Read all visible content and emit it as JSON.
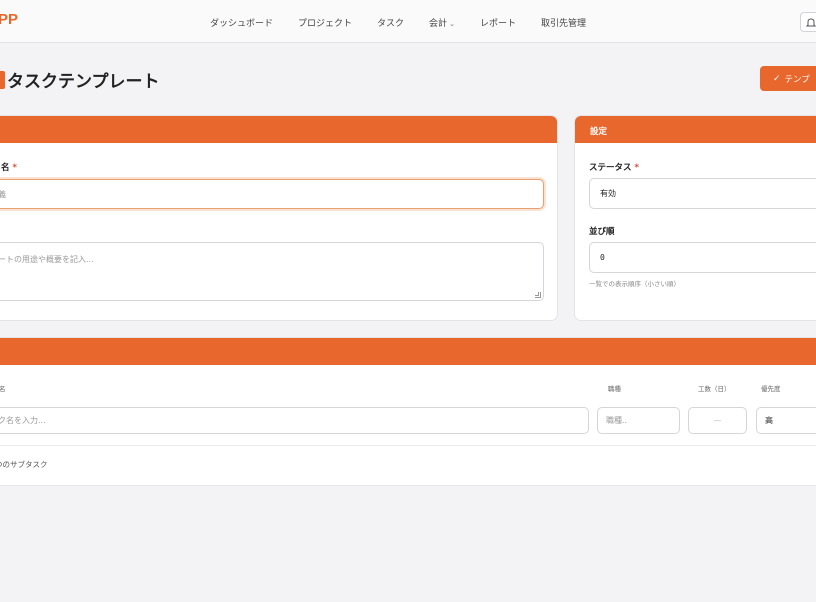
{
  "brand": {
    "name": "PP"
  },
  "nav": {
    "items": [
      {
        "label": "ダッシュボード"
      },
      {
        "label": "プロジェクト"
      },
      {
        "label": "タスク"
      },
      {
        "label": "会計",
        "caret": "⌄"
      },
      {
        "label": "レポート"
      },
      {
        "label": "取引先管理"
      }
    ]
  },
  "page": {
    "title": "タスクテンプレート"
  },
  "actions": {
    "save_label": "テンプ"
  },
  "basic": {
    "name_label": "名",
    "name_value": "義",
    "required_mark": "*",
    "desc_placeholder": "ートの用途や概要を記入..."
  },
  "settings": {
    "header": "設定",
    "status_label": "ステータス",
    "status_value": "有効",
    "order_label": "並び順",
    "order_value": "0",
    "order_hint": "一覧での表示順序（小さい順）"
  },
  "subtasks": {
    "columns": {
      "name": "名",
      "role": "職種",
      "hours": "工数（日）",
      "priority": "優先度"
    },
    "row": {
      "name_placeholder": "ク名を入力...",
      "role_placeholder": "職種..",
      "hours_placeholder": "—",
      "priority_value": "高"
    },
    "count_text": "つのサブタスク"
  },
  "colors": {
    "accent": "#e8672c",
    "required": "#e0483a"
  }
}
